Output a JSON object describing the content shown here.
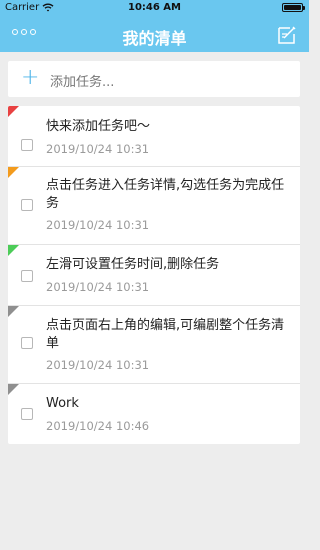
{
  "status_bar": {
    "carrier": "Carrier",
    "time": "10:46 AM"
  },
  "header": {
    "title": "我的清单",
    "more_icon": "ellipsis-icon",
    "edit_icon": "edit-list-icon"
  },
  "add_task": {
    "placeholder": "添加任务..."
  },
  "colors": {
    "header_bg": "#6ac7ef",
    "accent": "#4bb3e8",
    "flag_red": "#e84141",
    "flag_orange": "#f39b1d",
    "flag_green": "#4ccc58",
    "flag_gray": "#8f8f8f"
  },
  "tasks": [
    {
      "title": "快来添加任务吧～",
      "time": "2019/10/24 10:31",
      "priority_color": "#e84141",
      "checked": false
    },
    {
      "title": "点击任务进入任务详情,勾选任务为完成任务",
      "time": "2019/10/24 10:31",
      "priority_color": "#f39b1d",
      "checked": false
    },
    {
      "title": "左滑可设置任务时间,删除任务",
      "time": "2019/10/24 10:31",
      "priority_color": "#4ccc58",
      "checked": false
    },
    {
      "title": "点击页面右上角的编辑,可编剧整个任务清单",
      "time": "2019/10/24 10:31",
      "priority_color": "#8f8f8f",
      "checked": false
    },
    {
      "title": "Work",
      "time": "2019/10/24 10:46",
      "priority_color": "#8f8f8f",
      "checked": false
    }
  ]
}
